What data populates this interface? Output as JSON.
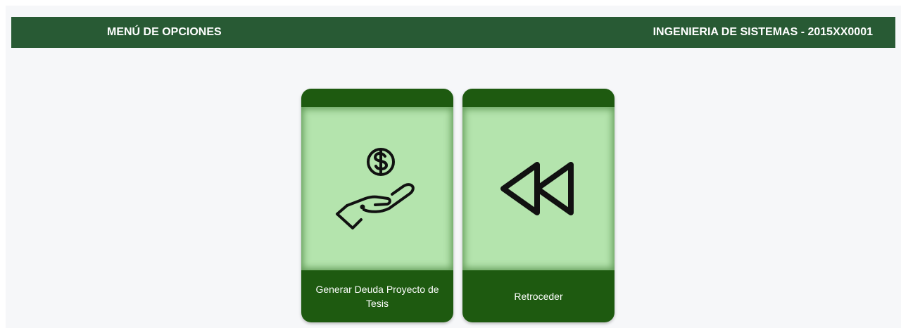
{
  "header": {
    "title": "MENÚ DE OPCIONES",
    "user_info": "INGENIERIA DE SISTEMAS - 2015XX0001",
    "background_color": "#285a34"
  },
  "menu": {
    "items": [
      {
        "label": "Generar Deuda Proyecto de Tesis",
        "icon": "hand-holding-dollar-icon"
      },
      {
        "label": "Retroceder",
        "icon": "rewind-icon"
      }
    ],
    "card_body_color": "#b4e4ad",
    "card_band_color": "#1e5a10"
  }
}
